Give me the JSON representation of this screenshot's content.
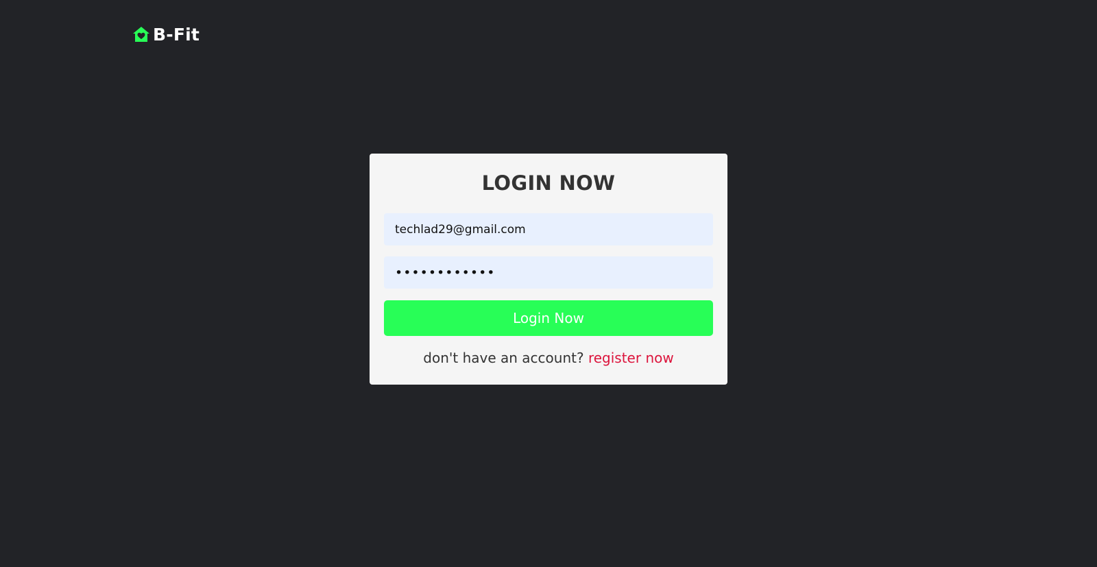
{
  "brand": {
    "name": "B-Fit",
    "icon": "home-heart-icon",
    "accent_color": "#28fe57"
  },
  "login_form": {
    "title": "LOGIN NOW",
    "email_value": "techlad29@gmail.com",
    "password_value": "••••••••••••",
    "submit_label": "Login Now",
    "register_prompt": "don't have an account?",
    "register_link_label": "register now",
    "link_color": "#dc143c"
  }
}
